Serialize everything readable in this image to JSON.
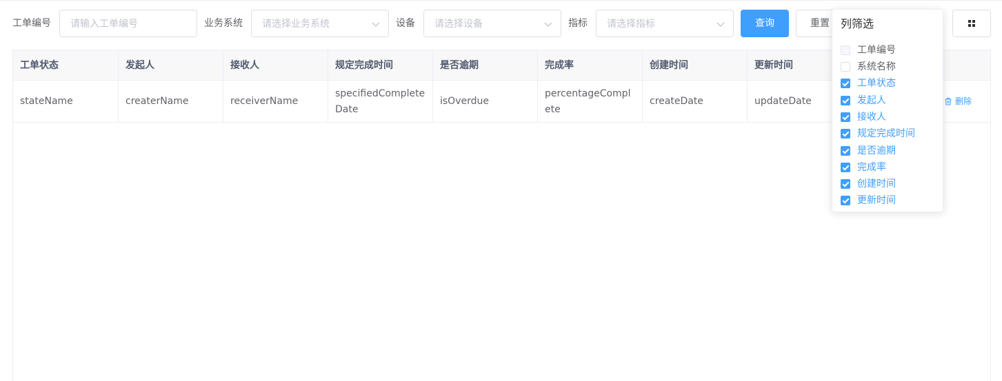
{
  "filters": {
    "work_order_label": "工单编号",
    "work_order_placeholder": "请输入工单编号",
    "system_label": "业务系统",
    "system_placeholder": "请选择业务系统",
    "device_label": "设备",
    "device_placeholder": "请选择设备",
    "metric_label": "指标",
    "metric_placeholder": "请选择指标",
    "query_button": "查询",
    "reset_button": "重置"
  },
  "table": {
    "headers": [
      "工单状态",
      "发起人",
      "接收人",
      "规定完成时间",
      "是否逾期",
      "完成率",
      "创建时间",
      "更新时间"
    ],
    "rows": [
      {
        "cells": [
          "stateName",
          "createrName",
          "receiverName",
          "specifiedCompleteDate",
          "isOverdue",
          "percentageComplete",
          "createDate",
          "updateDate"
        ],
        "delete_label": "删除"
      }
    ]
  },
  "column_filter": {
    "title": "列筛选",
    "items": [
      {
        "label": "工单编号",
        "state": "disabled"
      },
      {
        "label": "系统名称",
        "state": "unchecked"
      },
      {
        "label": "工单状态",
        "state": "checked"
      },
      {
        "label": "发起人",
        "state": "checked"
      },
      {
        "label": "接收人",
        "state": "checked"
      },
      {
        "label": "规定完成时间",
        "state": "checked"
      },
      {
        "label": "是否逾期",
        "state": "checked"
      },
      {
        "label": "完成率",
        "state": "checked"
      },
      {
        "label": "创建时间",
        "state": "checked"
      },
      {
        "label": "更新时间",
        "state": "checked"
      }
    ]
  },
  "icons": {
    "select_arrow": "chevron-down-icon",
    "delete": "trash-icon",
    "columns_toggle": "grid-icon"
  },
  "colors": {
    "primary": "#409eff",
    "border": "#dcdfe6",
    "header_bg": "#f8f8f9"
  }
}
